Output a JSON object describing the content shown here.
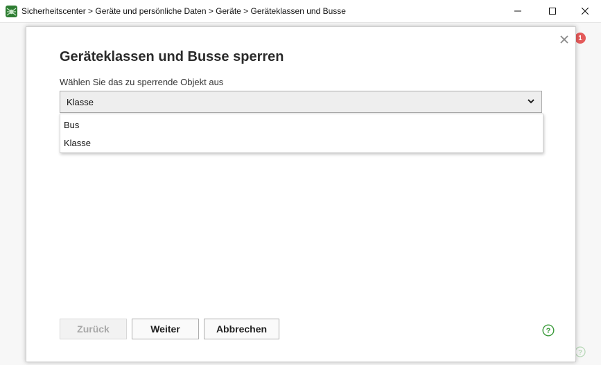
{
  "window": {
    "title": "Sicherheitscenter > Geräte und persönliche Daten > Geräte > Geräteklassen und Busse",
    "app_icon": "spider-logo-icon",
    "controls": [
      "minimize-icon",
      "maximize-icon",
      "close-icon"
    ]
  },
  "background": {
    "notification_count": "1"
  },
  "dialog": {
    "title": "Geräteklassen und Busse sperren",
    "prompt": "Wählen Sie das zu sperrende Objekt aus",
    "select": {
      "value": "Klasse",
      "expanded": true,
      "options": [
        "Bus",
        "Klasse"
      ]
    },
    "buttons": {
      "back": "Zurück",
      "next": "Weiter",
      "cancel": "Abbrechen"
    },
    "back_enabled": false,
    "icons": [
      "close-icon",
      "chevron-down-icon",
      "help-icon"
    ]
  },
  "colors": {
    "accent_green": "#3a9a3a",
    "badge_red": "#e45a5a",
    "disabled_text": "#a8a8a8"
  }
}
